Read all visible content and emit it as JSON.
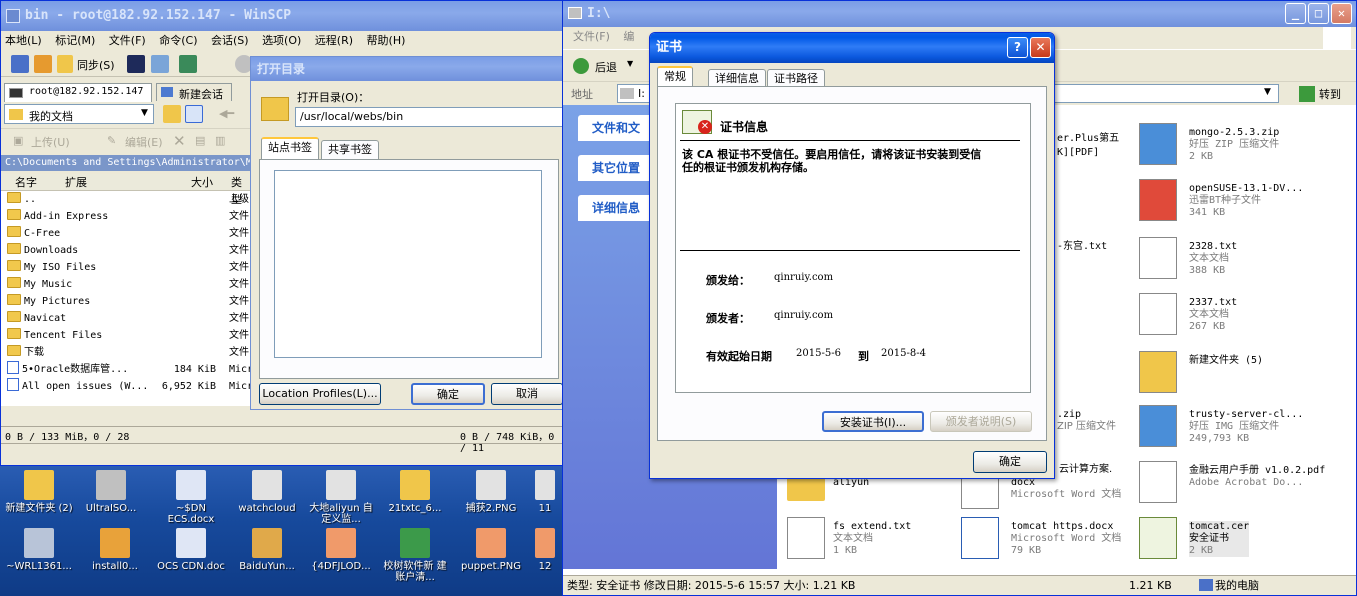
{
  "winscp": {
    "title": "bin - root@182.92.152.147 - WinSCP",
    "menu": [
      "本地(L)",
      "标记(M)",
      "文件(F)",
      "命令(C)",
      "会话(S)",
      "选项(O)",
      "远程(R)",
      "帮助(H)"
    ],
    "sync_label": "同步(S)",
    "session_tab": "root@182.92.152.147",
    "new_session_tab": "新建会话",
    "local_folder": "我的文档",
    "upload_label": "上传(U)",
    "edit_label": "编辑(E)",
    "local_path": "C:\\Documents and Settings\\Administrator\\M",
    "columns": [
      "名字",
      "扩展",
      "大小",
      "类型"
    ],
    "files": [
      {
        "name": "..",
        "size": "",
        "type": "上级"
      },
      {
        "name": "Add-in Express",
        "size": "",
        "type": "文件"
      },
      {
        "name": "C-Free",
        "size": "",
        "type": "文件"
      },
      {
        "name": "Downloads",
        "size": "",
        "type": "文件"
      },
      {
        "name": "My ISO Files",
        "size": "",
        "type": "文件"
      },
      {
        "name": "My Music",
        "size": "",
        "type": "文件"
      },
      {
        "name": "My Pictures",
        "size": "",
        "type": "文件"
      },
      {
        "name": "Navicat",
        "size": "",
        "type": "文件"
      },
      {
        "name": "Tencent Files",
        "size": "",
        "type": "文件"
      },
      {
        "name": "下载",
        "size": "",
        "type": "文件"
      },
      {
        "name": "5•Oracle数据库管...",
        "size": "184 KiB",
        "type": "Micr"
      },
      {
        "name": "All open issues (W...",
        "size": "6,952 KiB",
        "type": "Micr"
      }
    ],
    "status_left": "0 B / 133 MiB，0 / 28",
    "status_right": "0 B / 748 KiB，0 / 11"
  },
  "opendir": {
    "title": "打开目录",
    "label": "打开目录(O)：",
    "path": "/usr/local/webs/bin",
    "tabs": [
      "站点书签",
      "共享书签"
    ],
    "location_profiles": "Location Profiles(L)...",
    "ok": "确定",
    "cancel": "取消"
  },
  "desktop": {
    "row1": [
      "新建文件夹 (2)",
      "UltraISO...",
      "~$DN ECS.docx",
      "watchcloud",
      "大地aliyun 自定义监...",
      "21txtc_6...",
      "捕获2.PNG",
      "11"
    ],
    "row2": [
      "~WRL1361...",
      "install0...",
      "OCS CDN.doc",
      "BaiduYun...",
      "{4DFJLOD...",
      "校树软件新 建账户清...",
      "puppet.PNG",
      "12"
    ]
  },
  "explorer": {
    "title": "I:\\",
    "menu_file": "文件(F)",
    "menu_edit": "编",
    "back": "后退",
    "address_label": "地址",
    "address_val": "I:",
    "go": "转到",
    "panels": [
      "文件和文",
      "其它位置",
      "详细信息"
    ],
    "files": [
      {
        "name": "mongo-2.5.3.zip",
        "type": "好压 ZIP 压缩文件",
        "size": "2 KB"
      },
      {
        "name": "openSUSE-13.1-DV...",
        "type": "迅雷BT种子文件",
        "size": "341 KB"
      },
      {
        "name": "2328.txt",
        "type": "文本文档",
        "size": "388 KB"
      },
      {
        "name": "2337.txt",
        "type": "文本文档",
        "size": "267 KB"
      },
      {
        "name": "新建文件夹 (5)",
        "type": "",
        "size": ""
      },
      {
        "name": "trusty-server-cl...",
        "type": "好压 IMG 压缩文件",
        "size": "249,793 KB"
      },
      {
        "name": "金融云用户手册 v1.0.2.pdf",
        "type": "Adobe Acrobat Do...",
        "size": ""
      },
      {
        "name": "fs extend.txt",
        "type": "文本文档",
        "size": "1 KB"
      },
      {
        "name": "tomcat https.docx",
        "type": "Microsoft Word 文档",
        "size": "79 KB"
      },
      {
        "name": "tomcat.cer",
        "type": "安全证书",
        "size": "2 KB"
      }
    ],
    "partial": [
      "er.Plus第五",
      "K][PDF]",
      "-东宫.txt",
      ".zip",
      "ZIP 压缩文件",
      "云计算方案.",
      "docx",
      "Microsoft Word 文档",
      "aliyun"
    ],
    "status": "类型: 安全证书 修改日期: 2015-5-6 15:57 大小: 1.21 KB",
    "status_size": "1.21 KB",
    "status_loc": "我的电脑"
  },
  "cert": {
    "title": "证书",
    "tabs": [
      "常规",
      "详细信息",
      "证书路径"
    ],
    "info_title": "证书信息",
    "warning": "该 CA 根证书不受信任。要启用信任，请将该证书安装到受信任的根证书颁发机构存储。",
    "issued_to_label": "颁发给：",
    "issued_to": "qinruiy.com",
    "issued_by_label": "颁发者：",
    "issued_by": "qinruiy.com",
    "valid_label": "有效起始日期",
    "valid_from": "2015-5-6",
    "to_label": "到",
    "valid_to": "2015-8-4",
    "install_btn": "安装证书(I)...",
    "issuer_stmt": "颁发者说明(S)",
    "ok": "确定"
  }
}
